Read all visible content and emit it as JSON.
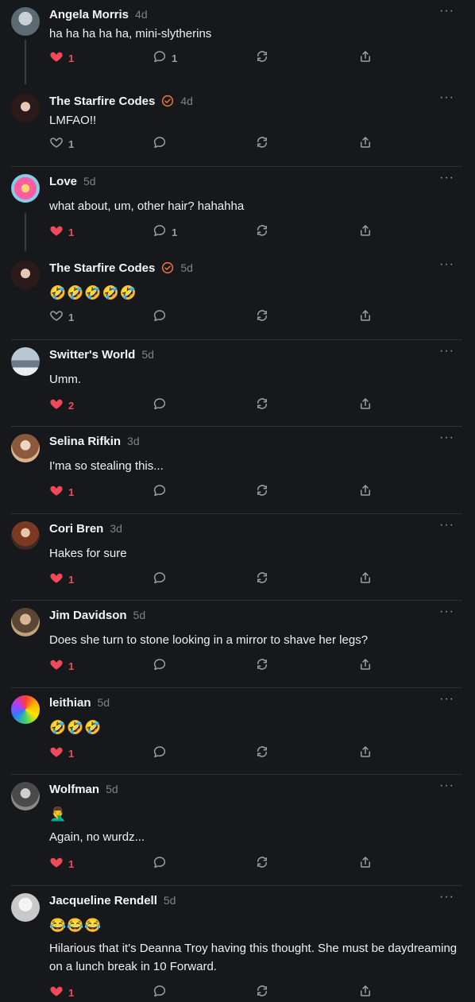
{
  "colors": {
    "background": "#17181b",
    "like_active": "#f04a5a",
    "verified": "#f07a3b",
    "muted": "#7e8288"
  },
  "icons": {
    "like": "heart-icon",
    "reply": "speech-bubble-icon",
    "repost": "repost-arrows-icon",
    "share": "share-upload-icon",
    "more": "more-dots-icon",
    "verified": "verified-check-icon"
  },
  "posts": [
    {
      "name": "Angela Morris",
      "time": "4d",
      "lines": [
        "ha ha ha ha ha, mini-slytherins"
      ],
      "likes": "1",
      "liked": true,
      "replies": "1",
      "verified": false
    },
    {
      "name": "The Starfire Codes",
      "time": "4d",
      "lines": [
        "LMFAO!!"
      ],
      "likes": "1",
      "liked": false,
      "replies": "",
      "verified": true
    },
    {
      "name": "Love",
      "time": "5d",
      "lines": [
        "what about, um, other hair? hahahha"
      ],
      "likes": "1",
      "liked": true,
      "replies": "1",
      "verified": false
    },
    {
      "name": "The Starfire Codes",
      "time": "5d",
      "lines": [
        "🤣🤣🤣🤣🤣"
      ],
      "likes": "1",
      "liked": false,
      "replies": "",
      "verified": true
    },
    {
      "name": "Switter's World",
      "time": "5d",
      "lines": [
        "Umm."
      ],
      "likes": "2",
      "liked": true,
      "replies": "",
      "verified": false
    },
    {
      "name": "Selina Rifkin",
      "time": "3d",
      "lines": [
        "I'ma so stealing this..."
      ],
      "likes": "1",
      "liked": true,
      "replies": "",
      "verified": false
    },
    {
      "name": "Cori Bren",
      "time": "3d",
      "lines": [
        "Hakes for sure"
      ],
      "likes": "1",
      "liked": true,
      "replies": "",
      "verified": false
    },
    {
      "name": "Jim Davidson",
      "time": "5d",
      "lines": [
        "Does she turn to stone looking in a mirror to shave her legs?"
      ],
      "likes": "1",
      "liked": true,
      "replies": "",
      "verified": false
    },
    {
      "name": "leithian",
      "time": "5d",
      "lines": [
        "🤣🤣🤣"
      ],
      "likes": "1",
      "liked": true,
      "replies": "",
      "verified": false
    },
    {
      "name": "Wolfman",
      "time": "5d",
      "lines": [
        "🤦‍♂️",
        "Again, no wurdz..."
      ],
      "likes": "1",
      "liked": true,
      "replies": "",
      "verified": false
    },
    {
      "name": "Jacqueline Rendell",
      "time": "5d",
      "lines": [
        "😂😂😂",
        "Hilarious that it's Deanna Troy having this thought. She must be daydreaming on a lunch break in 10 Forward."
      ],
      "likes": "1",
      "liked": true,
      "replies": "",
      "verified": false
    }
  ]
}
